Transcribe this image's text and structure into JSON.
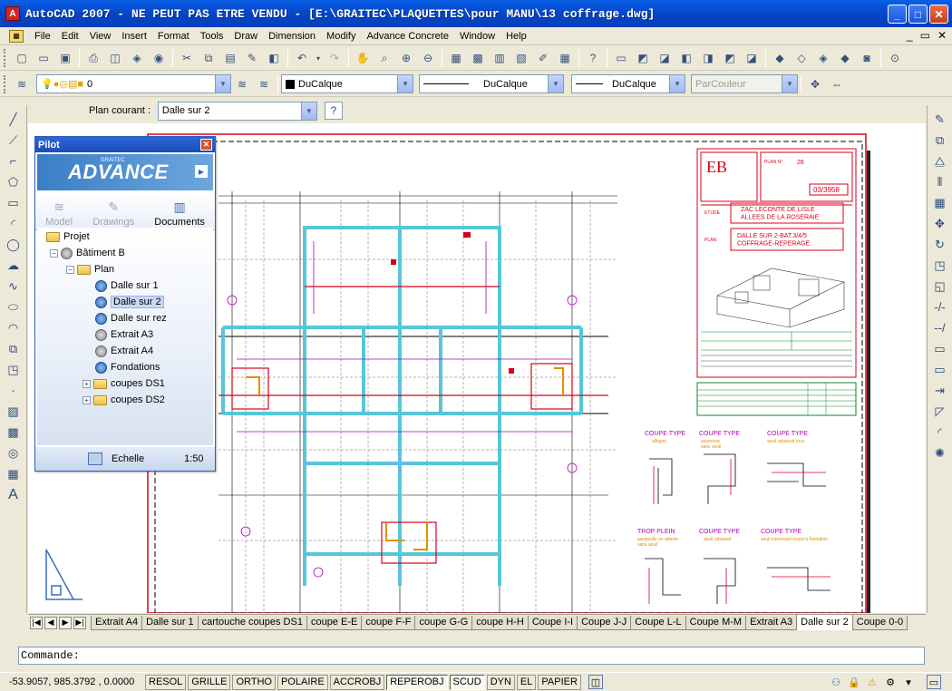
{
  "window": {
    "title": "AutoCAD 2007 - NE PEUT PAS ETRE VENDU - [E:\\GRAITEC\\PLAQUETTES\\pour MANU\\13 coffrage.dwg]",
    "app_icon_label": "A",
    "buttons": {
      "minimize": "_",
      "maximize": "□",
      "close": "✕"
    }
  },
  "menubar": {
    "items": [
      "File",
      "Edit",
      "View",
      "Insert",
      "Format",
      "Tools",
      "Draw",
      "Dimension",
      "Modify",
      "Advance Concrete",
      "Window",
      "Help"
    ],
    "mdi": {
      "minimize": "_",
      "restore": "▭",
      "close": "✕"
    }
  },
  "layers_toolbar": {
    "current_layer": "0",
    "color": "DuCalque",
    "linetype": "DuCalque",
    "lineweight": "DuCalque",
    "plotstyle": "ParCouleur"
  },
  "plan_toolbar": {
    "label": "Plan courant :",
    "value": "Dalle sur 2"
  },
  "pilot": {
    "title": "Pilot",
    "logo": "GRAITEC ADVANCE",
    "logo_brand": "GRAITEC",
    "logo_name": "ADVANCE",
    "tabs": [
      {
        "label": "Model",
        "active": false,
        "icon": "model-icon"
      },
      {
        "label": "Drawings",
        "active": false,
        "icon": "drawings-icon"
      },
      {
        "label": "Documents",
        "active": true,
        "icon": "documents-icon"
      }
    ],
    "tree": {
      "root": "Projet",
      "building": "Bâtiment B",
      "plan_folder": "Plan",
      "plans": [
        "Dalle sur 1",
        "Dalle sur 2",
        "Dalle sur rez",
        "Extrait A3",
        "Extrait A4",
        "Fondations"
      ],
      "selected": "Dalle sur 2",
      "section_folders": [
        "coupes DS1",
        "coupes DS2"
      ]
    },
    "footer": {
      "label": "Echelle",
      "value": "1:50"
    }
  },
  "drawing": {
    "title_block": {
      "company": "EB",
      "plan_no_label": "PLAN N°",
      "plan_no": "26",
      "ref": "03/3958",
      "etude_label": "ETUDE",
      "etude": "ZAC LECONTE DE LISLE\nALLEES DE LA ROSERAIE",
      "plan_label": "PLAN",
      "plan": "DALLE SUR 2-BAT.3/4/5\nCOFFRAGE-REPERAGE"
    },
    "details": [
      {
        "title": "COUPE TYPE",
        "sub": "allèges"
      },
      {
        "title": "COUPE TYPE",
        "sub": "ouverture\nsans seuil"
      },
      {
        "title": "COUPE TYPE",
        "sub": "seuil rabaissé tous"
      },
      {
        "title": "TROP PLEIN",
        "sub": "gargouille en attente\nsans seuil"
      },
      {
        "title": "COUPE TYPE",
        "sub": "seuil rabaissé"
      },
      {
        "title": "COUPE TYPE",
        "sub": "seuil traversant mural à fondation"
      }
    ]
  },
  "layout_tabs": {
    "items": [
      "Extrait A4",
      "Dalle sur 1",
      "cartouche coupes DS1",
      "coupe E-E",
      "coupe F-F",
      "coupe G-G",
      "coupe H-H",
      "Coupe I-I",
      "Coupe J-J",
      "Coupe L-L",
      "Coupe M-M",
      "Extrait A3",
      "Dalle sur 2",
      "Coupe 0-0"
    ],
    "active": "Dalle sur 2"
  },
  "command": {
    "prompt": "Commande:",
    "value": ""
  },
  "status": {
    "coords": "-53.9057, 985.3792 , 0.0000",
    "toggles": [
      {
        "label": "RESOL",
        "on": false
      },
      {
        "label": "GRILLE",
        "on": false
      },
      {
        "label": "ORTHO",
        "on": false
      },
      {
        "label": "POLAIRE",
        "on": false
      },
      {
        "label": "ACCROBJ",
        "on": false
      },
      {
        "label": "REPEROBJ",
        "on": true
      },
      {
        "label": "SCUD",
        "on": true
      },
      {
        "label": "DYN",
        "on": false
      },
      {
        "label": "EL",
        "on": false
      },
      {
        "label": "PAPIER",
        "on": false
      }
    ]
  },
  "colors": {
    "title_bar": "#0546c9",
    "xp_face": "#ece9d8",
    "cyan_beams": "#56c7d9",
    "red_layer": "#d8001b",
    "magenta": "#b000b0"
  }
}
